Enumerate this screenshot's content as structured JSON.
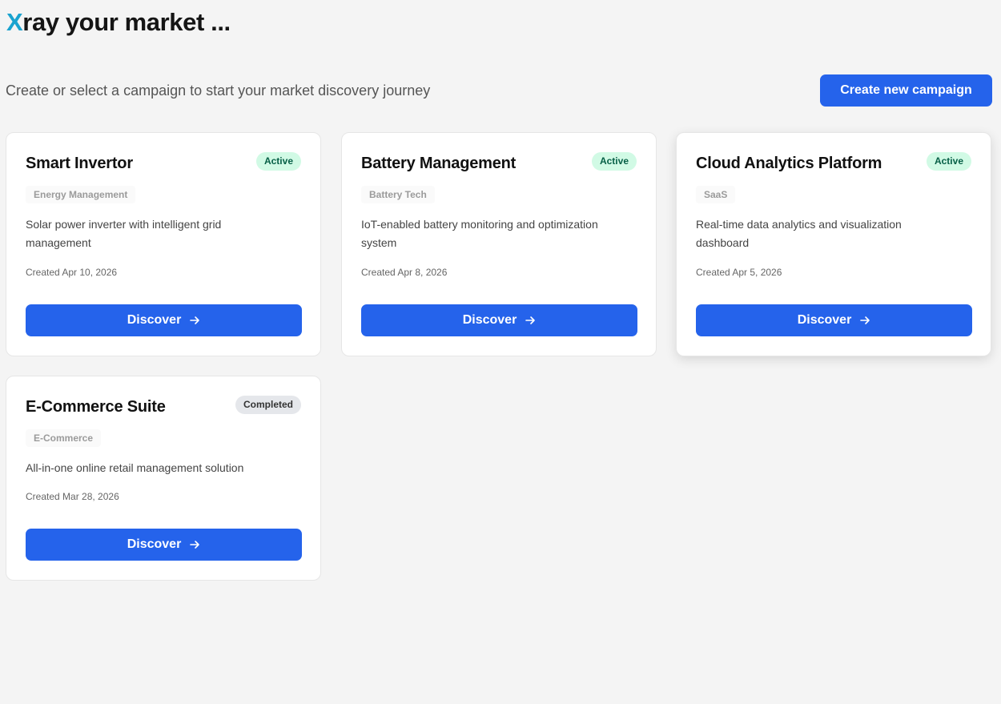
{
  "header": {
    "logo_first": "X",
    "logo_rest": "ray your market ...",
    "subtitle": "Create or select a campaign to start your market discovery journey",
    "create_button": "Create new campaign"
  },
  "colors": {
    "accent": "#2563eb",
    "logo_x": "#1aa3cf",
    "active_badge_bg": "#d1fae5",
    "completed_badge_bg": "#e5e7eb"
  },
  "campaigns": [
    {
      "title": "Smart Invertor",
      "status": "Active",
      "category": "Energy Management",
      "description": "Solar power inverter with intelligent grid management",
      "created": "Created Apr 10, 2026",
      "button": "Discover",
      "button_icon": "arrow-right-icon"
    },
    {
      "title": "Battery Management",
      "status": "Active",
      "category": "Battery Tech",
      "description": "IoT-enabled battery monitoring and optimization system",
      "created": "Created Apr 8, 2026",
      "button": "Discover",
      "button_icon": "arrow-right-icon"
    },
    {
      "title": "Cloud Analytics Platform",
      "status": "Active",
      "category": "SaaS",
      "description": "Real-time data analytics and visualization dashboard",
      "created": "Created Apr 5, 2026",
      "button": "Discover",
      "button_icon": "arrow-right-icon"
    },
    {
      "title": "E-Commerce Suite",
      "status": "Completed",
      "category": "E-Commerce",
      "description": "All-in-one online retail management solution",
      "created": "Created Mar 28, 2026",
      "button": "Discover",
      "button_icon": "arrow-right-icon"
    }
  ]
}
